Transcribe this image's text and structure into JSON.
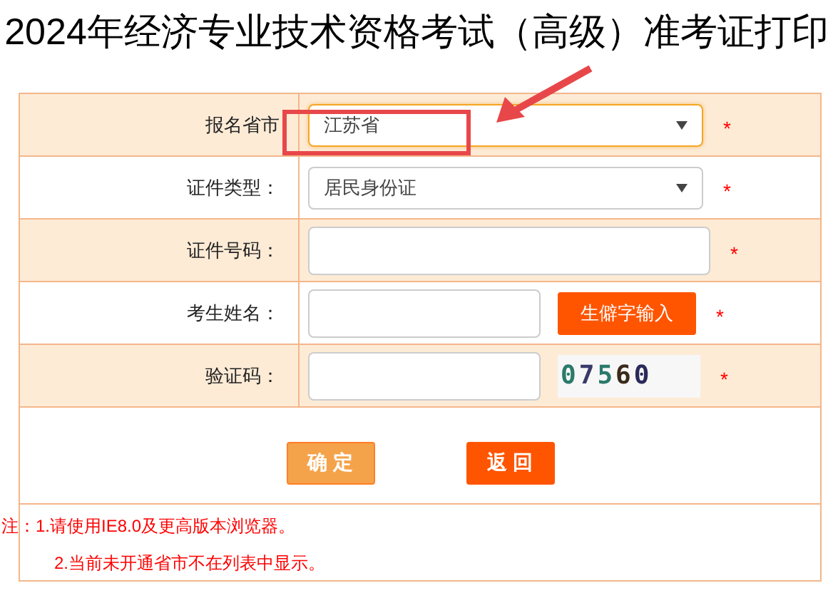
{
  "title": "2024年经济专业技术资格考试（高级）准考证打印",
  "form_rows": [
    {
      "kind": "select",
      "label": "报名省市",
      "value": "江苏省",
      "focused": true,
      "required": true
    },
    {
      "kind": "select",
      "label": "证件类型：",
      "value": "居民身份证",
      "focused": false,
      "required": true
    },
    {
      "kind": "text",
      "label": "证件号码：",
      "required": true
    },
    {
      "kind": "name",
      "label": "考生姓名：",
      "button": "生僻字输入",
      "required": true
    },
    {
      "kind": "captcha",
      "label": "验证码：",
      "captcha": "07560",
      "required": true
    }
  ],
  "buttons": [
    {
      "label": "确 定",
      "kind": "confirm"
    },
    {
      "label": "返 回",
      "kind": "back"
    }
  ],
  "notes": [
    "注：1.请使用IE8.0及更高版本浏览器。",
    "2.当前未开通省市不在列表中显示。"
  ],
  "required_mark": "*",
  "annotations": {
    "highlight_box": true,
    "arrow": true
  }
}
